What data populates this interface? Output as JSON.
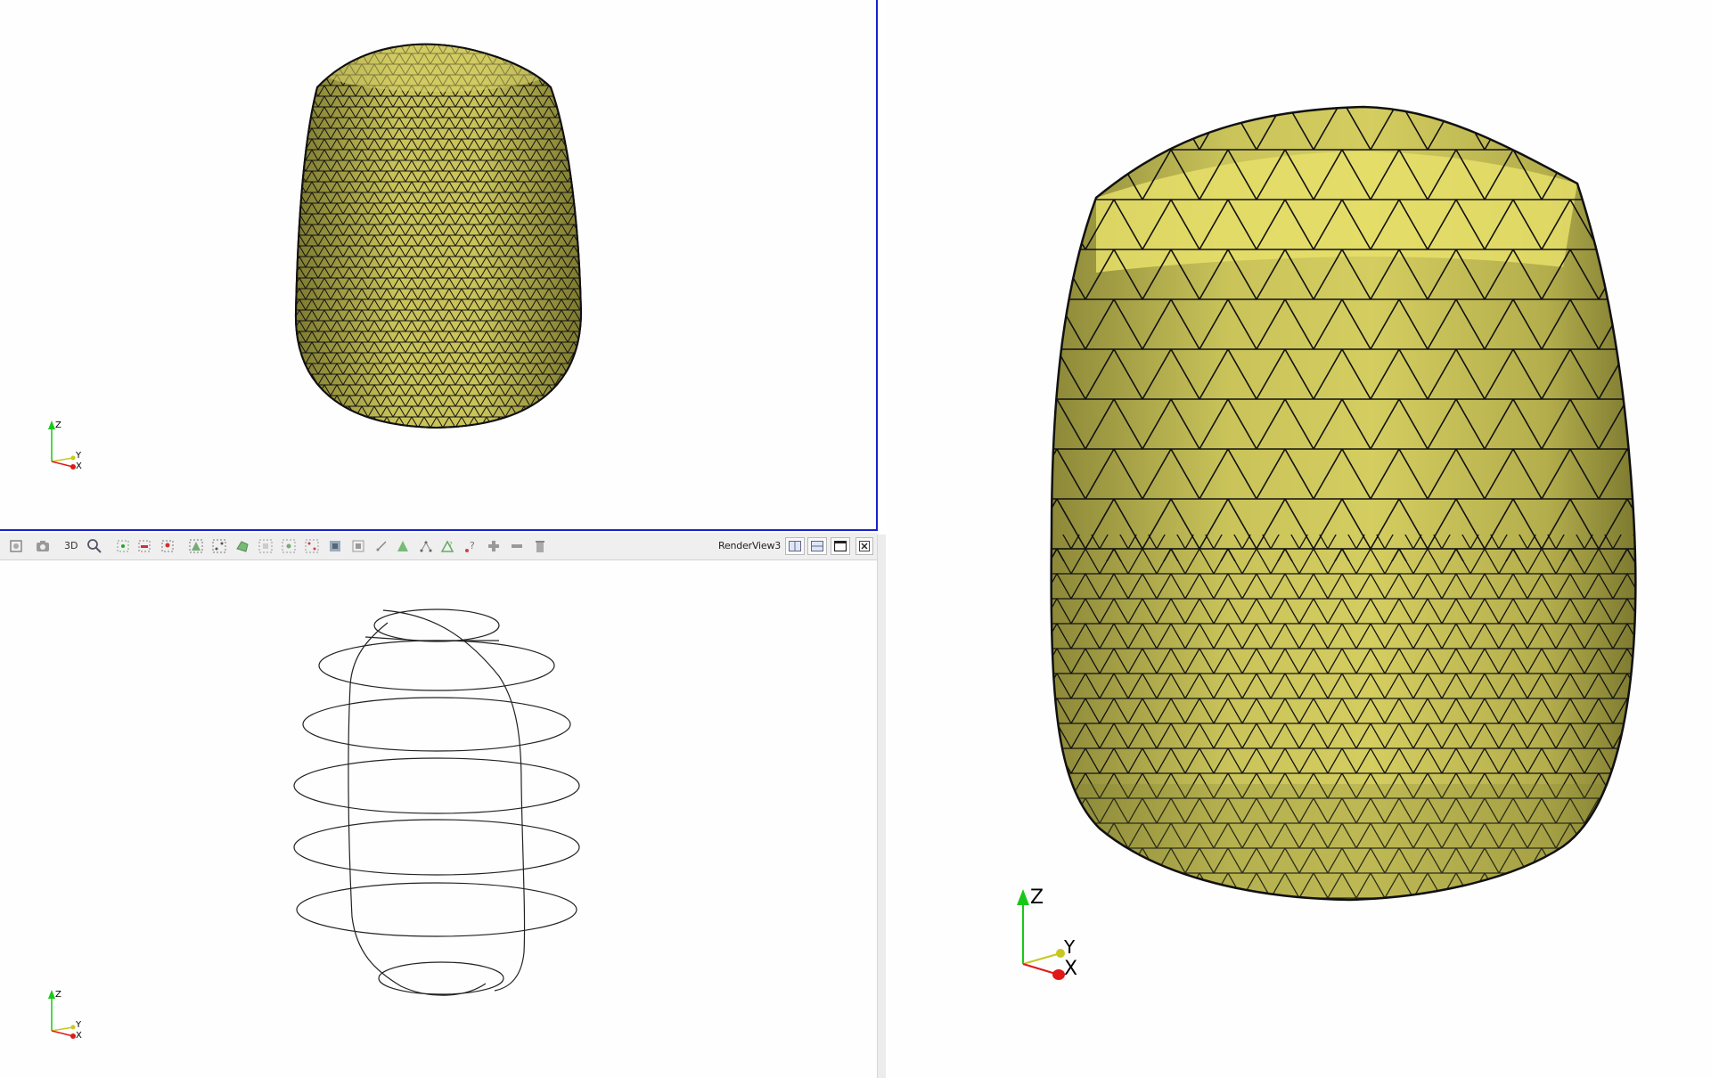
{
  "toolbar": {
    "mode_label": "3D",
    "view_name": "RenderView3",
    "icons": [
      "reset-camera-icon",
      "screenshot-icon",
      "zoom-to-box-icon",
      "select-points-icon",
      "select-cells-icon",
      "interactive-select-icon",
      "select-frustum-cells-icon",
      "select-frustum-points-icon",
      "select-polygon-icon",
      "select-block-icon",
      "hover-points-icon",
      "hover-cells-icon",
      "grow-selection-icon",
      "shrink-selection-icon",
      "clear-selection-icon",
      "query-icon",
      "add-icon",
      "remove-icon",
      "delete-icon"
    ],
    "layout_icons": [
      "split-horizontal-icon",
      "split-vertical-icon",
      "maximize-icon",
      "close-icon"
    ]
  },
  "views": {
    "top": {
      "description_icon": "meshed-barrel-icon",
      "axes": {
        "z": "Z",
        "y": "Y",
        "x": "X"
      }
    },
    "bottom": {
      "description_icon": "wireframe-contours-icon",
      "axes": {
        "z": "Z",
        "y": "Y",
        "x": "X"
      }
    },
    "right": {
      "description_icon": "coarse-meshed-barrel-icon",
      "axes": {
        "z": "Z",
        "y": "Y",
        "x": "X"
      }
    }
  },
  "colors": {
    "mesh_fill": "#c9c35a",
    "mesh_highlight": "#e8e06c",
    "mesh_shadow": "#8c8838",
    "edge": "#111111",
    "active_border": "#1a22c8",
    "axis_x": "#e01818",
    "axis_y": "#c8c820",
    "axis_z": "#18c818"
  }
}
